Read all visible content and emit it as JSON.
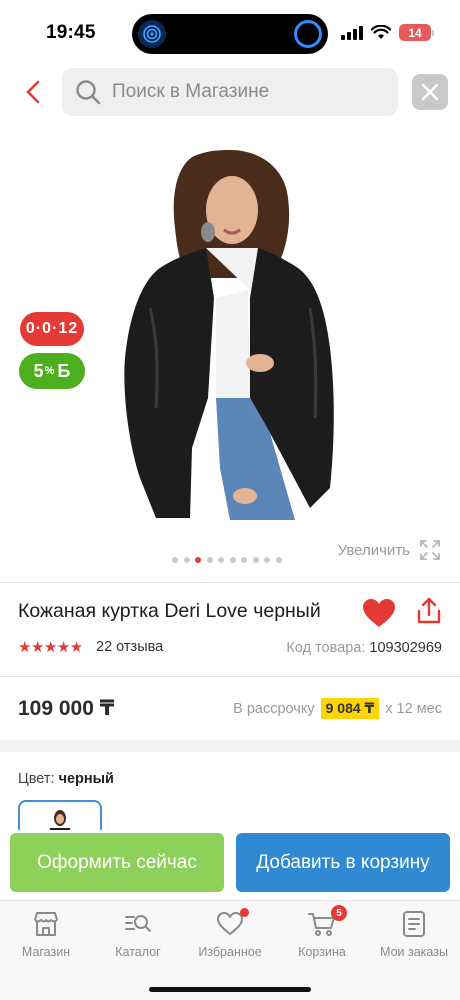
{
  "status_bar": {
    "time": "19:45",
    "battery_level": "14"
  },
  "search": {
    "placeholder": "Поиск в Магазине"
  },
  "gallery": {
    "installment_badge": "0·0·12",
    "bonus_badge_value": "5",
    "bonus_badge_percent": "%",
    "bonus_badge_currency": "Б",
    "zoom_label": "Увеличить",
    "dots_total": 10,
    "active_dot": 2
  },
  "product": {
    "title": "Кожаная куртка Deri Love черный",
    "stars": "★★★★★",
    "reviews": "22 отзыва",
    "sku_label": "Код товара:",
    "sku_value": "109302969",
    "price": "109 000 ₸",
    "installment_label": "В рассрочку",
    "installment_amount": "9 084 ₸",
    "installment_term": "х 12 мес",
    "color_label": "Цвет:",
    "color_value": "черный"
  },
  "actions": {
    "buy_now": "Оформить сейчас",
    "add_to_cart": "Добавить в корзину"
  },
  "tabs": [
    {
      "label": "Магазин",
      "icon": "store-icon"
    },
    {
      "label": "Каталог",
      "icon": "catalog-search-icon"
    },
    {
      "label": "Избранное",
      "icon": "heart-icon"
    },
    {
      "label": "Корзина",
      "icon": "cart-icon",
      "badge": "5"
    },
    {
      "label": "Мои заказы",
      "icon": "orders-icon"
    }
  ],
  "colors": {
    "accent_red": "#e53935",
    "bonus_green": "#4caf1d",
    "buy_green": "#8dd15b",
    "cart_blue": "#2f89d3",
    "installment_yellow": "#ffd400"
  }
}
